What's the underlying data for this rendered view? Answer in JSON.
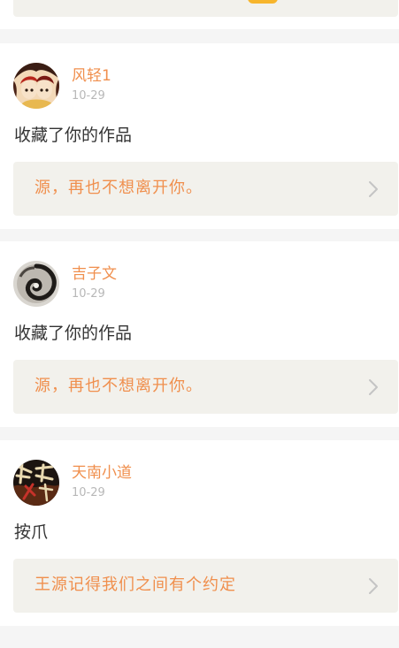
{
  "feed": {
    "items": [
      {
        "username": "风轻1",
        "time": "10-29",
        "action": "收藏了你的作品",
        "work_title": "源，再也不想离开你。",
        "avatar_icon": "anime-girl-avatar"
      },
      {
        "username": "吉子文",
        "time": "10-29",
        "action": "收藏了你的作品",
        "work_title": "源，再也不想离开你。",
        "avatar_icon": "swirl-avatar"
      },
      {
        "username": "天南小道",
        "time": "10-29",
        "action": "按爪",
        "work_title": "王源记得我们之间有个约定",
        "avatar_icon": "calligraphy-avatar"
      }
    ]
  },
  "colors": {
    "accent": "#f08f4d",
    "card_bg": "#f2f1ec",
    "page_bg": "#f5f5f5",
    "text": "#333333",
    "muted": "#b8b8b8"
  }
}
